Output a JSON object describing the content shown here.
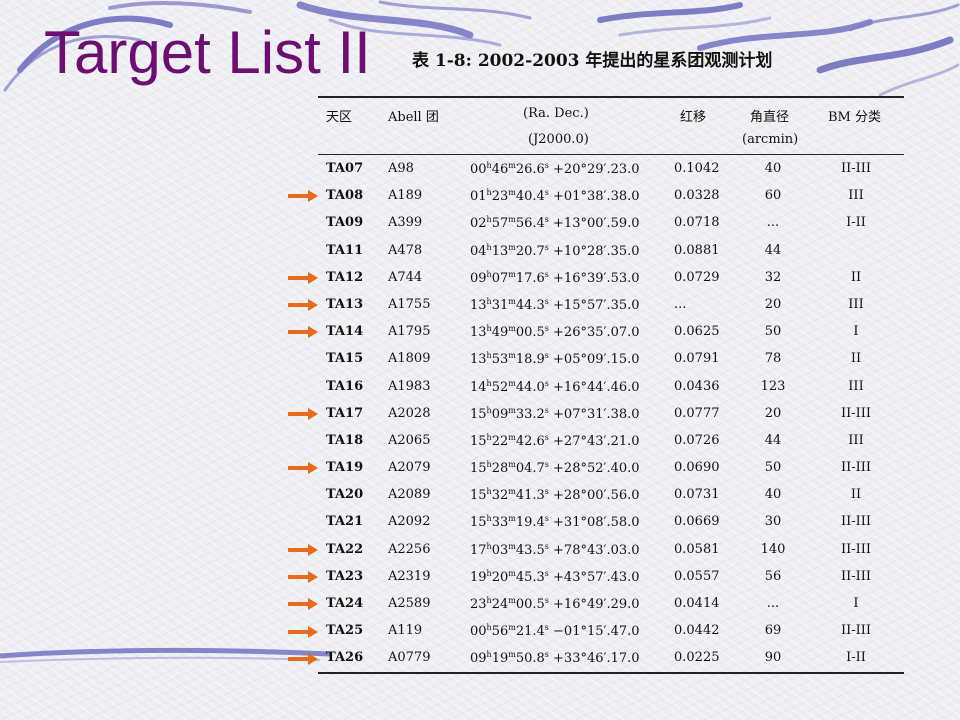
{
  "title": "Target List II",
  "caption": "表 1-8:  2002-2003 年提出的星系团观测计划",
  "colors": {
    "title": "#6d0f72",
    "arrow": "#e86a1a",
    "swoosh": "#6a6bbf"
  },
  "headers": {
    "region": "天区",
    "abell": "Abell 团",
    "radec": "(Ra.  Dec.)",
    "epoch": "(J2000.0)",
    "redshift": "红移",
    "angdiam": "角直径",
    "angunit": "(arcmin)",
    "bm": "BM 分类"
  },
  "rows": [
    {
      "ta": "TA07",
      "abell": "A98",
      "ra_h": "00",
      "ra_m": "46",
      "ra_s": "26.6",
      "dec": "+20°29′.23.0",
      "z": "0.1042",
      "ang": "40",
      "bm": "II-III",
      "arrow": false
    },
    {
      "ta": "TA08",
      "abell": "A189",
      "ra_h": "01",
      "ra_m": "23",
      "ra_s": "40.4",
      "dec": "+01°38′.38.0",
      "z": "0.0328",
      "ang": "60",
      "bm": "III",
      "arrow": true
    },
    {
      "ta": "TA09",
      "abell": "A399",
      "ra_h": "02",
      "ra_m": "57",
      "ra_s": "56.4",
      "dec": "+13°00′.59.0",
      "z": "0.0718",
      "ang": "...",
      "bm": "I-II",
      "arrow": false
    },
    {
      "ta": "TA11",
      "abell": "A478",
      "ra_h": "04",
      "ra_m": "13",
      "ra_s": "20.7",
      "dec": "+10°28′.35.0",
      "z": "0.0881",
      "ang": "44",
      "bm": "",
      "arrow": false
    },
    {
      "ta": "TA12",
      "abell": "A744",
      "ra_h": "09",
      "ra_m": "07",
      "ra_s": "17.6",
      "dec": "+16°39′.53.0",
      "z": "0.0729",
      "ang": "32",
      "bm": "II",
      "arrow": true
    },
    {
      "ta": "TA13",
      "abell": "A1755",
      "ra_h": "13",
      "ra_m": "31",
      "ra_s": "44.3",
      "dec": "+15°57′.35.0",
      "z": "...",
      "ang": "20",
      "bm": "III",
      "arrow": true
    },
    {
      "ta": "TA14",
      "abell": "A1795",
      "ra_h": "13",
      "ra_m": "49",
      "ra_s": "00.5",
      "dec": "+26°35′.07.0",
      "z": "0.0625",
      "ang": "50",
      "bm": "I",
      "arrow": true
    },
    {
      "ta": "TA15",
      "abell": "A1809",
      "ra_h": "13",
      "ra_m": "53",
      "ra_s": "18.9",
      "dec": "+05°09′.15.0",
      "z": "0.0791",
      "ang": "78",
      "bm": "II",
      "arrow": false
    },
    {
      "ta": "TA16",
      "abell": "A1983",
      "ra_h": "14",
      "ra_m": "52",
      "ra_s": "44.0",
      "dec": "+16°44′.46.0",
      "z": "0.0436",
      "ang": "123",
      "bm": "III",
      "arrow": false
    },
    {
      "ta": "TA17",
      "abell": "A2028",
      "ra_h": "15",
      "ra_m": "09",
      "ra_s": "33.2",
      "dec": "+07°31′.38.0",
      "z": "0.0777",
      "ang": "20",
      "bm": "II-III",
      "arrow": true
    },
    {
      "ta": "TA18",
      "abell": "A2065",
      "ra_h": "15",
      "ra_m": "22",
      "ra_s": "42.6",
      "dec": "+27°43′.21.0",
      "z": "0.0726",
      "ang": "44",
      "bm": "III",
      "arrow": false
    },
    {
      "ta": "TA19",
      "abell": "A2079",
      "ra_h": "15",
      "ra_m": "28",
      "ra_s": "04.7",
      "dec": "+28°52′.40.0",
      "z": "0.0690",
      "ang": "50",
      "bm": "II-III",
      "arrow": true
    },
    {
      "ta": "TA20",
      "abell": "A2089",
      "ra_h": "15",
      "ra_m": "32",
      "ra_s": "41.3",
      "dec": "+28°00′.56.0",
      "z": "0.0731",
      "ang": "40",
      "bm": "II",
      "arrow": false
    },
    {
      "ta": "TA21",
      "abell": "A2092",
      "ra_h": "15",
      "ra_m": "33",
      "ra_s": "19.4",
      "dec": "+31°08′.58.0",
      "z": "0.0669",
      "ang": "30",
      "bm": "II-III",
      "arrow": false
    },
    {
      "ta": "TA22",
      "abell": "A2256",
      "ra_h": "17",
      "ra_m": "03",
      "ra_s": "43.5",
      "dec": "+78°43′.03.0",
      "z": "0.0581",
      "ang": "140",
      "bm": "II-III",
      "arrow": true
    },
    {
      "ta": "TA23",
      "abell": "A2319",
      "ra_h": "19",
      "ra_m": "20",
      "ra_s": "45.3",
      "dec": "+43°57′.43.0",
      "z": "0.0557",
      "ang": "56",
      "bm": "II-III",
      "arrow": true
    },
    {
      "ta": "TA24",
      "abell": "A2589",
      "ra_h": "23",
      "ra_m": "24",
      "ra_s": "00.5",
      "dec": "+16°49′.29.0",
      "z": "0.0414",
      "ang": "...",
      "bm": "I",
      "arrow": true
    },
    {
      "ta": "TA25",
      "abell": "A119",
      "ra_h": "00",
      "ra_m": "56",
      "ra_s": "21.4",
      "dec": "−01°15′.47.0",
      "z": "0.0442",
      "ang": "69",
      "bm": "II-III",
      "arrow": true
    },
    {
      "ta": "TA26",
      "abell": "A0779",
      "ra_h": "09",
      "ra_m": "19",
      "ra_s": "50.8",
      "dec": "+33°46′.17.0",
      "z": "0.0225",
      "ang": "90",
      "bm": "I-II",
      "arrow": true
    }
  ]
}
